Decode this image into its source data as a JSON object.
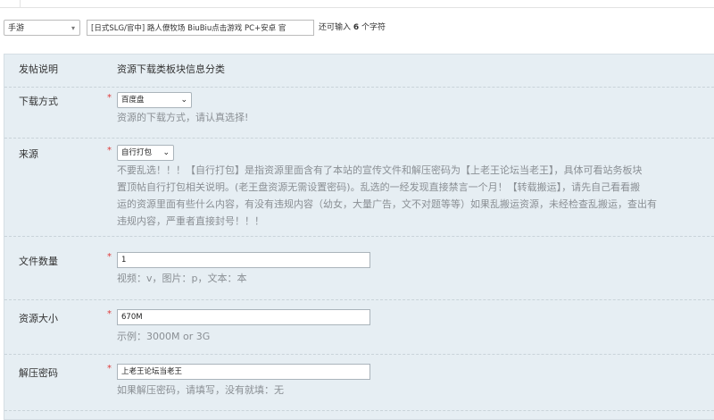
{
  "header": {
    "type_select": "手游",
    "title_value": "[日式SLG/官中] 路人僚牧场 BiuBiu点击游戏 PC+安卓 官",
    "remain_prefix": "还可输入",
    "remain_count": "6",
    "remain_suffix": "个字符"
  },
  "form": {
    "intro": {
      "label": "发帖说明",
      "value": "资源下载类板块信息分类"
    },
    "download": {
      "label": "下载方式",
      "selected": "百度盘",
      "help": "资源的下载方式，请认真选择!"
    },
    "source": {
      "label": "来源",
      "selected": "自行打包",
      "help_lines": [
        "不要乱选！！！【自行打包】是指资源里面含有了本站的宣传文件和解压密码为【上老王论坛当老王】，具体可看站务板块",
        "置顶帖自行打包相关说明。(老王盘资源无需设置密码)。乱选的一经发现直接禁言一个月！【转载搬运】，请先自己看看搬",
        "运的资源里面有些什么内容，有没有违规内容（幼女，大量广告，文不对题等等）如果乱搬运资源，未经检查乱搬运，查出有",
        "违规内容，严重者直接封号！！！"
      ]
    },
    "file_count": {
      "label": "文件数量",
      "value": "1",
      "help": "视频：v，图片：p，文本：本"
    },
    "size": {
      "label": "资源大小",
      "value": "670M",
      "help": "示例：3000M or 3G"
    },
    "password": {
      "label": "解压密码",
      "value": "上老王论坛当老王",
      "help": "如果解压密码，请填写，没有就填：无"
    }
  }
}
